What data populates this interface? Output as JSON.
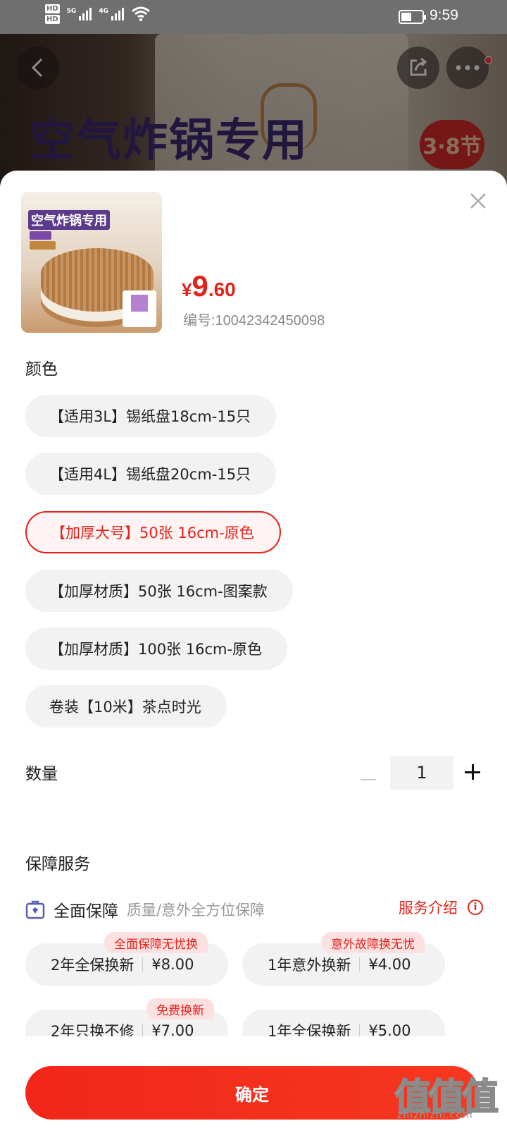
{
  "status_bar": {
    "hd1": "HD",
    "hd2": "HD",
    "net1": "5G",
    "net2": "4G",
    "time": "9:59"
  },
  "banner": {
    "title": "空气炸锅专用",
    "badge": "3·8节"
  },
  "product": {
    "thumb_title": "空气炸锅专用",
    "price_currency": "¥",
    "price_integer": "9",
    "price_decimal": ".60",
    "sku": "编号:10042342450098"
  },
  "color_section": {
    "title": "颜色",
    "options": [
      {
        "label": "【适用3L】锡纸盘18cm-15只",
        "selected": false
      },
      {
        "label": "【适用4L】锡纸盘20cm-15只",
        "selected": false
      },
      {
        "label": "【加厚大号】50张 16cm-原色",
        "selected": true
      },
      {
        "label": "【加厚材质】50张 16cm-图案款",
        "selected": false
      },
      {
        "label": "【加厚材质】100张 16cm-原色",
        "selected": false
      },
      {
        "label": "卷装【10米】茶点时光",
        "selected": false
      }
    ]
  },
  "quantity": {
    "title": "数量",
    "value": "1"
  },
  "guarantee": {
    "title": "保障服务",
    "name": "全面保障",
    "desc": "质量/意外全方位保障",
    "link": "服务介绍",
    "info": "i",
    "services": [
      {
        "name": "2年全保换新",
        "price": "¥8.00",
        "tag": "全面保障无忧换"
      },
      {
        "name": "1年意外换新",
        "price": "¥4.00",
        "tag": "意外故障换无忧"
      },
      {
        "name": "2年只换不修",
        "price": "¥7.00",
        "tag": "免费换新"
      },
      {
        "name": "1年全保换新",
        "price": "¥5.00",
        "tag": ""
      }
    ]
  },
  "confirm_label": "确定",
  "watermark": {
    "big": "值值值",
    "small": "zhizhizhi.com"
  },
  "colors": {
    "accent": "#e2231a",
    "chip_bg": "#f2f2f2",
    "tag_bg": "#fde1e1"
  }
}
